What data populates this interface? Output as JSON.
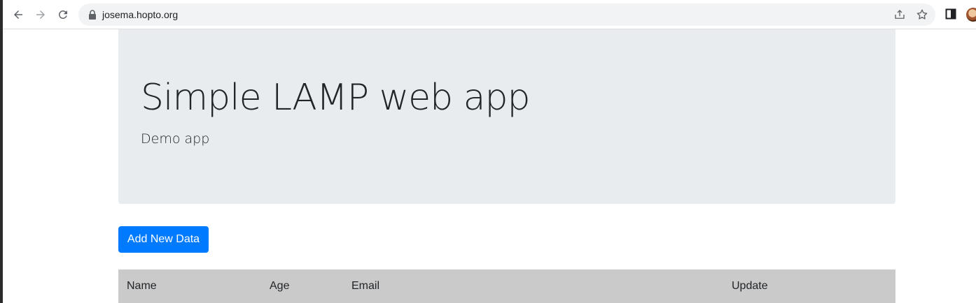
{
  "browser": {
    "url": "josema.hopto.org"
  },
  "jumbotron": {
    "title": "Simple LAMP web app",
    "lead": "Demo app"
  },
  "actions": {
    "add_button": "Add New Data"
  },
  "table": {
    "headers": [
      "Name",
      "Age",
      "Email",
      "Update"
    ]
  },
  "colors": {
    "primary": "#007bff",
    "jumbotron_bg": "#e9ecef",
    "table_header_bg": "#cacaca"
  }
}
